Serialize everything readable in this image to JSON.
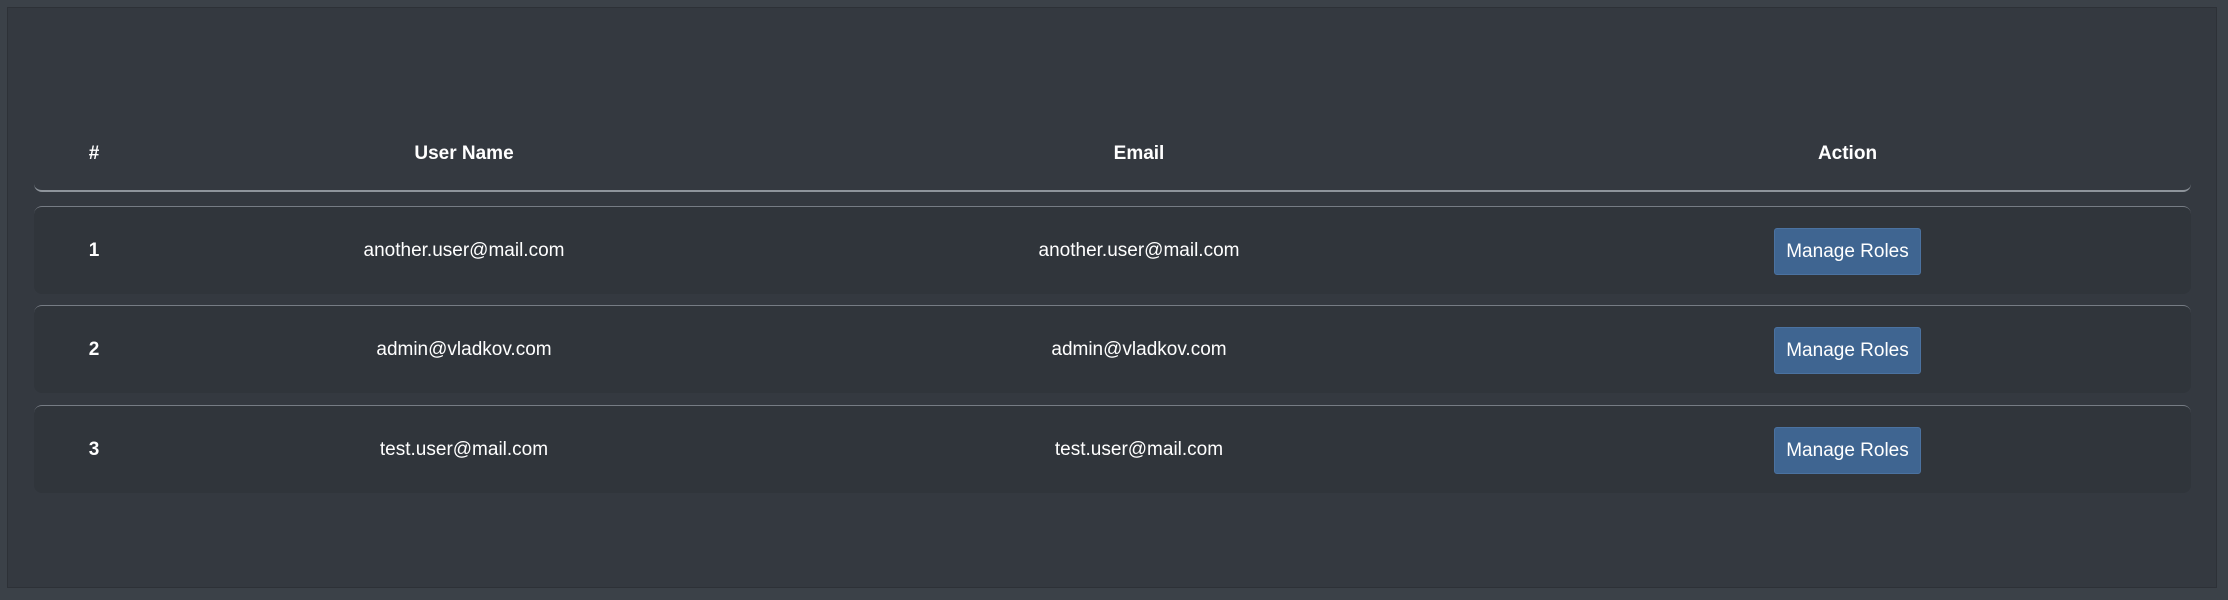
{
  "table": {
    "headers": {
      "number": "#",
      "user_name": "User Name",
      "email": "Email",
      "action": "Action"
    },
    "rows": [
      {
        "number": "1",
        "user_name": "another.user@mail.com",
        "email": "another.user@mail.com",
        "action_label": "Manage Roles"
      },
      {
        "number": "2",
        "user_name": "admin@vladkov.com",
        "email": "admin@vladkov.com",
        "action_label": "Manage Roles"
      },
      {
        "number": "3",
        "user_name": "test.user@mail.com",
        "email": "test.user@mail.com",
        "action_label": "Manage Roles"
      }
    ]
  },
  "colors": {
    "background": "#343940",
    "button": "#3f6591",
    "text": "#ffffff"
  }
}
